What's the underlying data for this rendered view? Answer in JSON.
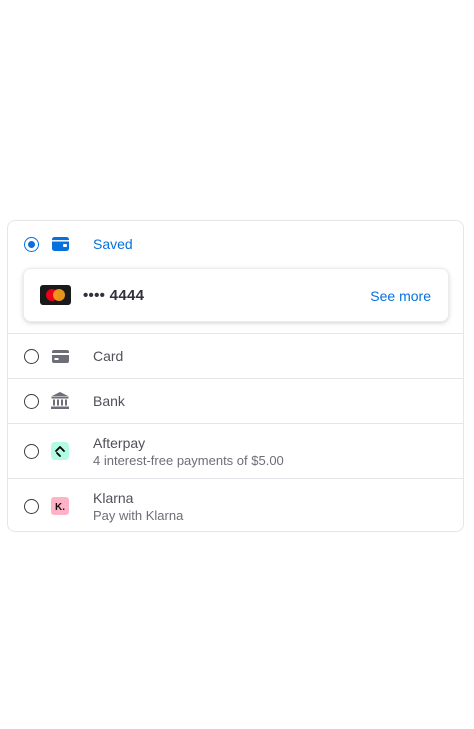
{
  "colors": {
    "accent": "#0570de",
    "text": "#50505a",
    "subtext": "#6d6e78",
    "border": "#e6e6ea",
    "afterpay_bg": "#b2fce4",
    "klarna_bg": "#ffb3c7"
  },
  "saved": {
    "label": "Saved",
    "icon": "wallet-icon",
    "selected": true,
    "card": {
      "brand_icon": "mastercard-icon",
      "number": "•••• 4444",
      "see_more": "See more"
    }
  },
  "methods": [
    {
      "label": "Card",
      "icon": "credit-card-icon"
    },
    {
      "label": "Bank",
      "icon": "bank-icon"
    },
    {
      "label": "Afterpay",
      "sub": "4 interest-free payments of $5.00",
      "icon": "afterpay-icon"
    },
    {
      "label": "Klarna",
      "sub": "Pay with Klarna",
      "icon": "klarna-icon",
      "icon_text": "K."
    }
  ]
}
